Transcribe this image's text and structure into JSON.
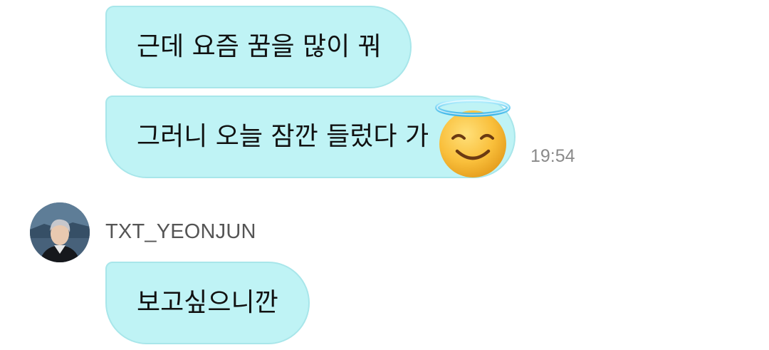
{
  "messages": [
    {
      "text": "근데 요즘 꿈을 많이 꿔"
    },
    {
      "text": "그러니 오늘 잠깐 들렀다 가",
      "emoji": "smiling-face-with-halo",
      "time": "19:54"
    },
    {
      "sender": "TXT_YEONJUN",
      "text": "보고싶으니깐"
    }
  ],
  "colors": {
    "bubble_bg": "#bff3f5",
    "bubble_border": "#a8e6ea",
    "time_text": "#8a8a8a",
    "sender_text": "#555555"
  }
}
